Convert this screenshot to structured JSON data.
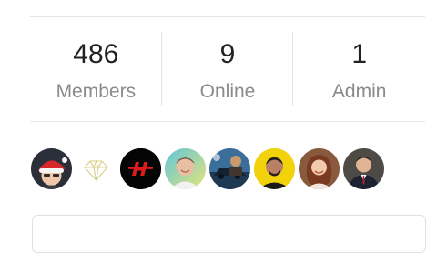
{
  "stats": [
    {
      "value": "486",
      "label": "Members"
    },
    {
      "value": "9",
      "label": "Online"
    },
    {
      "value": "1",
      "label": "Admin"
    }
  ],
  "avatars": [
    {
      "name": "avatar-santa-hat-man-icon"
    },
    {
      "name": "avatar-diamond-logo-icon"
    },
    {
      "name": "avatar-red-h-logo-icon"
    },
    {
      "name": "avatar-smiling-man-icon"
    },
    {
      "name": "avatar-car-photo-icon"
    },
    {
      "name": "avatar-man-yellow-bg-icon"
    },
    {
      "name": "avatar-woman-icon"
    },
    {
      "name": "avatar-man-suit-icon"
    }
  ]
}
